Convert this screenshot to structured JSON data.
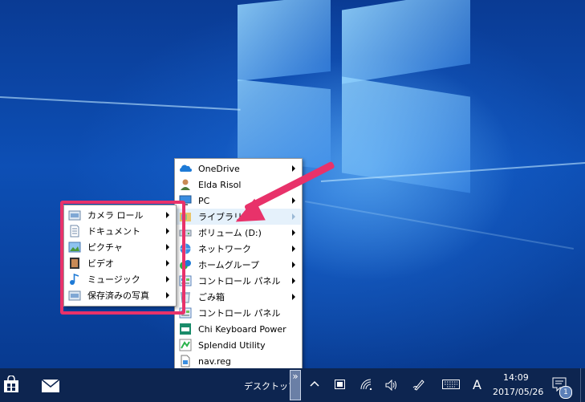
{
  "main_menu": {
    "items": [
      {
        "label": "OneDrive",
        "icon": "onedrive-icon",
        "arrow": true
      },
      {
        "label": "Elda Risol",
        "icon": "user-icon",
        "arrow": true
      },
      {
        "label": "PC",
        "icon": "pc-icon",
        "arrow": true
      },
      {
        "label": "ライブラリ",
        "icon": "library-icon",
        "arrow": true,
        "highlight": true
      },
      {
        "label": "ボリューム (D:)",
        "icon": "drive-icon",
        "arrow": true
      },
      {
        "label": "ネットワーク",
        "icon": "network-icon",
        "arrow": true
      },
      {
        "label": "ホームグループ",
        "icon": "homegroup-icon",
        "arrow": true
      },
      {
        "label": "コントロール パネル",
        "icon": "control-panel-icon",
        "arrow": true
      },
      {
        "label": "ごみ箱",
        "icon": "recycle-bin-icon",
        "arrow": true
      },
      {
        "label": "コントロール パネル",
        "icon": "control-panel-icon",
        "arrow": false
      },
      {
        "label": "Chi Keyboard Power",
        "icon": "keyboard-app-icon",
        "arrow": false
      },
      {
        "label": "Splendid Utility",
        "icon": "splendid-icon",
        "arrow": false
      },
      {
        "label": "nav.reg",
        "icon": "registry-file-icon",
        "arrow": false
      }
    ]
  },
  "sub_menu": {
    "items": [
      {
        "label": "カメラ ロール",
        "icon": "library-folder-icon"
      },
      {
        "label": "ドキュメント",
        "icon": "documents-icon"
      },
      {
        "label": "ピクチャ",
        "icon": "pictures-icon"
      },
      {
        "label": "ビデオ",
        "icon": "videos-icon"
      },
      {
        "label": "ミュージック",
        "icon": "music-icon"
      },
      {
        "label": "保存済みの写真",
        "icon": "library-folder-icon"
      }
    ]
  },
  "taskbar": {
    "toolbar_label": "デスクトップ",
    "toolbar_chevron": "»",
    "ime": "A",
    "time": "14:09",
    "date": "2017/05/26",
    "notification_count": "1"
  },
  "colors": {
    "accent": "#e8326a",
    "taskbar": "#0d2550",
    "highlight": "#e5f1fb"
  }
}
